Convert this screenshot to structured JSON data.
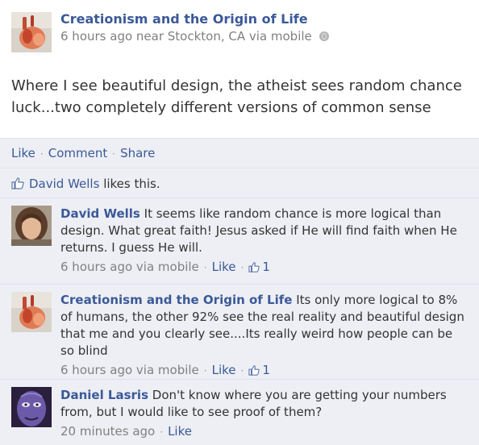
{
  "post": {
    "author": "Creationism and the Origin of Life",
    "meta": "6 hours ago near Stockton, CA via mobile",
    "text": "Where I see beautiful design, the atheist sees random chance luck...two completely different versions of common sense"
  },
  "actions": {
    "like": "Like",
    "comment": "Comment",
    "share": "Share"
  },
  "likes": {
    "name": "David Wells",
    "suffix": " likes this."
  },
  "comments": [
    {
      "author": "David Wells",
      "text": "It seems like random chance is more logical than design. What great faith! Jesus asked if He will find faith when He returns. I guess He will.",
      "time": "6 hours ago via mobile",
      "like": "Like",
      "like_count": "1"
    },
    {
      "author": "Creationism and the Origin of Life",
      "text": "Its only more logical to 8% of humans, the other 92% see the real reality and beautiful design that me and you clearly see....Its really weird how people can be so blind",
      "time": "6 hours ago via mobile",
      "like": "Like",
      "like_count": "1"
    },
    {
      "author": "Daniel Lasris",
      "text": "Don't know where you are getting your numbers from, but I would like to see proof of them?",
      "time": "20 minutes ago",
      "like": "Like"
    }
  ],
  "colors": {
    "link": "#3b5998",
    "panel": "#edeff4",
    "meta": "#808080"
  },
  "icons": {
    "thumbs_up": "thumbs-up-icon",
    "globe": "globe-icon"
  }
}
